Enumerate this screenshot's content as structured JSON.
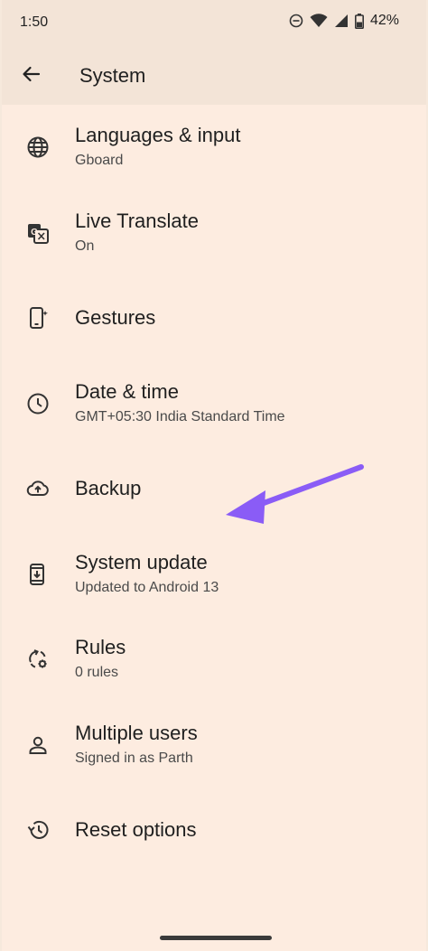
{
  "status_bar": {
    "time": "1:50",
    "battery_percent": "42%",
    "icons": [
      "do-not-disturb-icon",
      "wifi-icon",
      "signal-icon",
      "battery-icon"
    ]
  },
  "app_bar": {
    "title": "System",
    "back_icon": "arrow-back-icon"
  },
  "colors": {
    "background": "#fdece0",
    "header": "#f3e4d7",
    "annotation_arrow": "#8a5cf6"
  },
  "items": [
    {
      "title": "Languages & input",
      "subtitle": "Gboard",
      "icon": "globe-icon"
    },
    {
      "title": "Live Translate",
      "subtitle": "On",
      "icon": "translate-icon"
    },
    {
      "title": "Gestures",
      "subtitle": "",
      "icon": "gestures-phone-icon"
    },
    {
      "title": "Date & time",
      "subtitle": "GMT+05:30 India Standard Time",
      "icon": "clock-icon"
    },
    {
      "title": "Backup",
      "subtitle": "",
      "icon": "cloud-upload-icon"
    },
    {
      "title": "System update",
      "subtitle": "Updated to Android 13",
      "icon": "system-update-icon"
    },
    {
      "title": "Rules",
      "subtitle": "0 rules",
      "icon": "rules-icon"
    },
    {
      "title": "Multiple users",
      "subtitle": "Signed in as Parth",
      "icon": "person-icon"
    },
    {
      "title": "Reset options",
      "subtitle": "",
      "icon": "history-icon"
    }
  ]
}
